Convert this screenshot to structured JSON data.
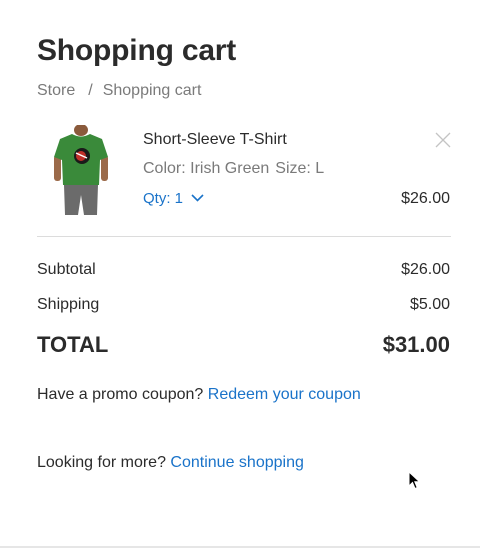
{
  "page": {
    "title": "Shopping cart"
  },
  "breadcrumb": {
    "items": [
      "Store",
      "Shopping cart"
    ],
    "separator": "/"
  },
  "cart_item": {
    "name": "Short-Sleeve T-Shirt",
    "color_label": "Color: Irish Green",
    "size_label": "Size: L",
    "qty_label": "Qty: 1",
    "price": "$26.00",
    "image_icon": "green-t-shirt-product-image",
    "shirt_color": "#3a8a3a"
  },
  "summary": {
    "subtotal_label": "Subtotal",
    "subtotal_value": "$26.00",
    "shipping_label": "Shipping",
    "shipping_value": "$5.00",
    "total_label": "TOTAL",
    "total_value": "$31.00"
  },
  "promo": {
    "prompt": "Have a promo coupon?",
    "link": "Redeem your coupon"
  },
  "more": {
    "prompt": "Looking for more?",
    "link": "Continue shopping"
  },
  "colors": {
    "link": "#1a73c9",
    "text": "#2b2b2b",
    "muted": "#7a7a7a"
  }
}
